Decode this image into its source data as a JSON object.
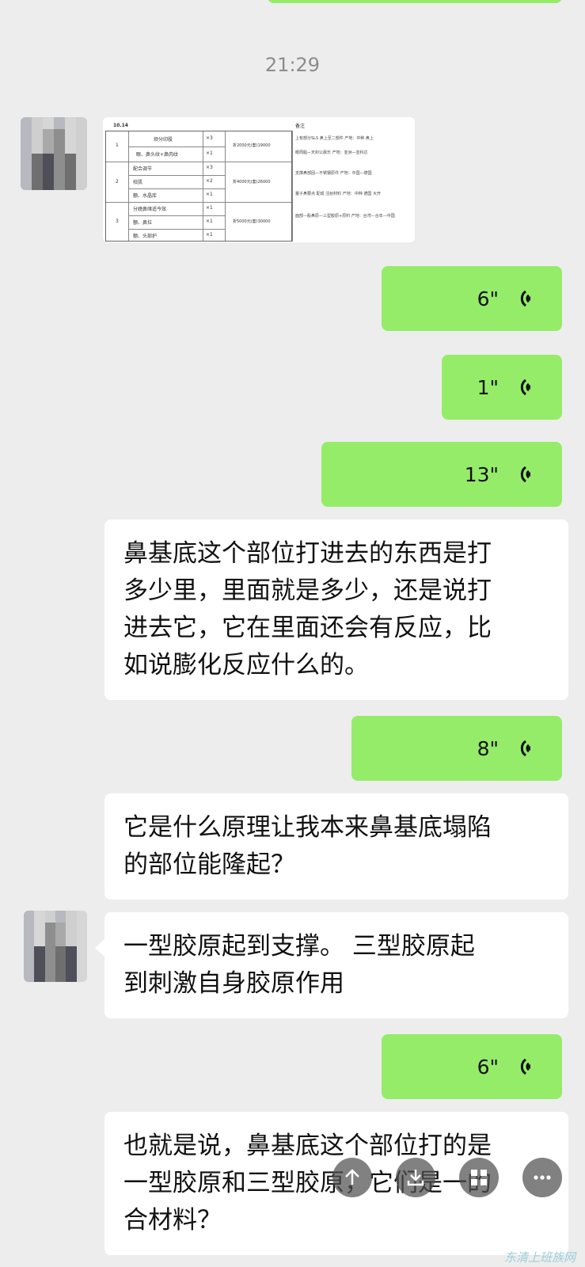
{
  "chat": {
    "timestamp": "21:29",
    "image_message": {
      "header": "10.14",
      "rows": [
        {
          "no": "1",
          "items": [
            {
              "name": "烦分印股",
              "qty": "×3"
            },
            {
              "name": "眼、鼻头纹+鼻肉纹",
              "qty": "×1"
            }
          ],
          "price": "折2000元(套)19000"
        },
        {
          "no": "2",
          "items": [
            {
              "name": "配合调节",
              "qty": "×3"
            },
            {
              "name": "校肌",
              "qty": "×2"
            },
            {
              "name": "额、水晶库",
              "qty": "×1"
            }
          ],
          "price": "折4000元(套)26000"
        },
        {
          "no": "3",
          "items": [
            {
              "name": "分娩鼻绪适今效",
              "qty": "×1"
            },
            {
              "name": "额、鼻拉",
              "qty": "×1"
            },
            {
              "name": "额、头部护",
              "qty": "×1"
            }
          ],
          "price": "折5000元(套)30000"
        }
      ],
      "notes_title": "备注",
      "notes": [
        "上有部分SLS 鼻上至二部件 产地：中种 鼻上",
        "眼周脂—天封公晨乐 产地：亚洲—亚科达",
        "支撑鼻部固—不锈钢原件 产地：中国—德国",
        "童子鼻要点 配成 注射材料 产地：中种 德国 大开",
        "面部—股鼻原—三型胶原+原料 产地：台湾—合年—中国"
      ]
    },
    "messages": [
      {
        "type": "voice",
        "duration": "6\""
      },
      {
        "type": "voice",
        "duration": "1\""
      },
      {
        "type": "voice",
        "duration": "13\""
      },
      {
        "type": "text",
        "lines": [
          "鼻基底这个部位打进去的东西是打",
          "多少里，里面就是多少，还是说打",
          "进去它，它在里面还会有反应，比",
          "如说膨化反应什么的。"
        ]
      },
      {
        "type": "voice",
        "duration": "8\""
      },
      {
        "type": "text",
        "lines": [
          "它是什么原理让我本来鼻基底塌陷",
          "的部位能隆起？"
        ]
      },
      {
        "type": "text",
        "lines": [
          "一型胶原起到支撑。 三型胶原起",
          "到刺激自身胶原作用"
        ]
      },
      {
        "type": "voice",
        "duration": "6\""
      },
      {
        "type": "text",
        "lines": [
          "也就是说，鼻基底这个部位打的是",
          "一型胶原和三型胶原，它们是一的",
          "合材料？"
        ]
      }
    ],
    "floating_buttons": [
      {
        "icon": "share-icon",
        "label": "share"
      },
      {
        "icon": "download-icon",
        "label": "download"
      },
      {
        "icon": "grid-icon",
        "label": "more-apps"
      },
      {
        "icon": "more-icon",
        "label": "more"
      }
    ],
    "watermark": "东清上班族网"
  },
  "colors": {
    "background": "#ededed",
    "sent_bubble": "#95ec69",
    "received_bubble": "#ffffff",
    "timestamp": "#8c8c8c"
  }
}
